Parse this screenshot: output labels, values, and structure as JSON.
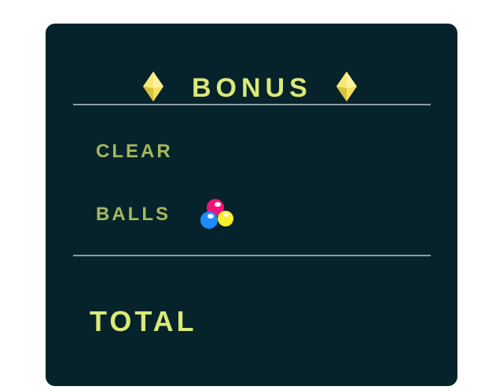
{
  "header": {
    "title": "BONUS",
    "left_icon": "diamond-gem-icon",
    "right_icon": "diamond-gem-icon"
  },
  "rows": [
    {
      "label": "CLEAR"
    },
    {
      "label": "BALLS",
      "icon": "three-balls-icon"
    }
  ],
  "footer": {
    "total_label": "TOTAL"
  },
  "colors": {
    "panel_background": "#06232b",
    "title_text": "#dbe978",
    "row_label_text": "#a6b85d",
    "divider": "#8c9ea6",
    "gem_yellow": "#f4e15a",
    "ball_pink": "#f0147a",
    "ball_blue": "#1a8cff",
    "ball_yellow": "#f7f02a"
  }
}
